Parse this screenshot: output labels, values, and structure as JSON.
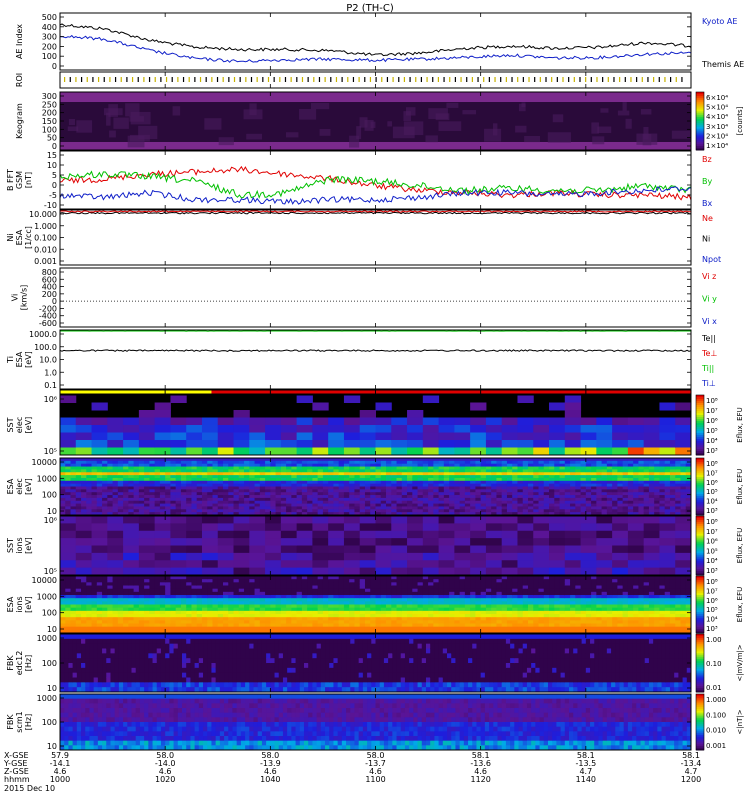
{
  "title": "P2 (TH-C)",
  "colors": {
    "black": "#000000",
    "blue": "#1020c8",
    "red": "#e00000",
    "green": "#00c000",
    "yellow": "#ffff00",
    "purple": "#3c0a5a",
    "darkbg": "#12001e"
  },
  "panels": [
    {
      "key": "ae",
      "ylabel": [
        "AE Index"
      ],
      "yticks": [
        "500",
        "400",
        "300",
        "200",
        "100",
        "0"
      ],
      "legend": [
        {
          "text": "Kyoto AE",
          "color": "#1020c8"
        },
        {
          "text": "Themis AE",
          "color": "#000000"
        }
      ]
    },
    {
      "key": "roi",
      "ylabel": [
        "ROI"
      ],
      "yticks": [],
      "legend": []
    },
    {
      "key": "keogram",
      "ylabel": [
        "Keogram"
      ],
      "yticks": [
        "300",
        "250",
        "200",
        "150",
        "100",
        "50",
        "0"
      ],
      "legend": []
    },
    {
      "key": "bfield",
      "ylabel": [
        "B FFT",
        "GSM",
        "[nT]"
      ],
      "yticks": [
        "15",
        "10",
        "5",
        "0",
        "-5",
        "-10"
      ],
      "legend": [
        {
          "text": "Bz",
          "color": "#e00000"
        },
        {
          "text": "By",
          "color": "#00c000"
        },
        {
          "text": "Bx",
          "color": "#1020c8"
        }
      ]
    },
    {
      "key": "density",
      "ylabel": [
        "Ni",
        "ESA",
        "[1/cc]"
      ],
      "yticks": [
        "10.000",
        "1.000",
        "0.100",
        "0.010",
        "0.001"
      ],
      "legend": [
        {
          "text": "Ne",
          "color": "#e00000"
        },
        {
          "text": "Ni",
          "color": "#000000"
        },
        {
          "text": "Npot",
          "color": "#1020c8"
        }
      ]
    },
    {
      "key": "velocity",
      "ylabel": [
        "Vi",
        "[km/s]"
      ],
      "yticks": [
        "800",
        "600",
        "400",
        "200",
        "0",
        "-200",
        "-400",
        "-600"
      ],
      "legend": [
        {
          "text": "Vi z",
          "color": "#e00000"
        },
        {
          "text": "Vi y",
          "color": "#00c000"
        },
        {
          "text": "Vi x",
          "color": "#1020c8"
        }
      ]
    },
    {
      "key": "temp",
      "ylabel": [
        "Ti",
        "ESA",
        "[eV]"
      ],
      "yticks": [
        "1000.0",
        "100.0",
        "10.0",
        "1.0",
        "0.1"
      ],
      "legend": [
        {
          "text": "Te||",
          "color": "#000000"
        },
        {
          "text": "Te⊥",
          "color": "#e00000"
        },
        {
          "text": "Ti||",
          "color": "#00c000"
        },
        {
          "text": "Ti⊥",
          "color": "#1020c8"
        }
      ]
    },
    {
      "key": "mode",
      "ylabel": [],
      "yticks": [],
      "legend": []
    },
    {
      "key": "sst_e",
      "ylabel": [
        "SST",
        "elec",
        "[eV]"
      ],
      "yticks": [
        "10⁶",
        "10⁵"
      ],
      "legend": []
    },
    {
      "key": "esa_e",
      "ylabel": [
        "ESA",
        "elec",
        "[eV]"
      ],
      "yticks": [
        "10000",
        "1000",
        "100",
        "10"
      ],
      "legend": []
    },
    {
      "key": "sst_i",
      "ylabel": [
        "SST",
        "ions",
        "[eV]"
      ],
      "yticks": [
        "10⁶",
        "10⁵"
      ],
      "legend": []
    },
    {
      "key": "esa_i",
      "ylabel": [
        "ESA",
        "ions",
        "[eV]"
      ],
      "yticks": [
        "10000",
        "1000",
        "100",
        "10"
      ],
      "legend": []
    },
    {
      "key": "fbk_e",
      "ylabel": [
        "FBK",
        "edc12",
        "[Hz]"
      ],
      "yticks": [
        "1000",
        "100",
        "10"
      ],
      "legend": []
    },
    {
      "key": "fbk_b",
      "ylabel": [
        "FBK",
        "scm1",
        "[Hz]"
      ],
      "yticks": [
        "1000",
        "100",
        "10"
      ],
      "legend": []
    }
  ],
  "colorbars": [
    {
      "key": "keogram",
      "ticks": [
        "6×10⁴",
        "5×10⁴",
        "4×10⁴",
        "3×10⁴",
        "2×10⁴",
        "1×10⁴"
      ],
      "label": "[counts]"
    },
    {
      "key": "sst_e",
      "ticks": [
        "10⁸",
        "10⁷",
        "10⁶",
        "10⁵",
        "10⁴",
        "10³"
      ],
      "label": "Eflux, EFU"
    },
    {
      "key": "esa_e",
      "ticks": [
        "10⁸",
        "10⁷",
        "10⁶",
        "10⁵",
        "10⁴",
        "10³"
      ],
      "label": "Eflux, EFU"
    },
    {
      "key": "sst_i",
      "ticks": [
        "10⁸",
        "10⁷",
        "10⁶",
        "10⁵",
        "10⁴",
        "10³"
      ],
      "label": "Eflux, EFU"
    },
    {
      "key": "esa_i",
      "ticks": [
        "10⁸",
        "10⁷",
        "10⁶",
        "10⁵",
        "10⁴",
        "10³"
      ],
      "label": "Eflux, EFU"
    },
    {
      "key": "fbk_e",
      "ticks": [
        "1.00",
        "0.10",
        "0.01"
      ],
      "label": "<|mV/m|>"
    },
    {
      "key": "fbk_b",
      "ticks": [
        "1.000",
        "0.100",
        "0.010",
        "0.001"
      ],
      "label": "<|nT|>"
    }
  ],
  "footer": {
    "row_labels": [
      "X-GSE",
      "Y-GSE",
      "Z-GSE",
      "hhmm",
      "2015 Dec 10"
    ],
    "columns": [
      {
        "x": "57.9",
        "y": "-14.1",
        "z": "4.6",
        "t": "1000"
      },
      {
        "x": "58.0",
        "y": "-14.0",
        "z": "4.6",
        "t": "1020"
      },
      {
        "x": "58.0",
        "y": "-13.9",
        "z": "4.6",
        "t": "1040"
      },
      {
        "x": "58.0",
        "y": "-13.7",
        "z": "4.6",
        "t": "1100"
      },
      {
        "x": "58.1",
        "y": "-13.6",
        "z": "4.6",
        "t": "1120"
      },
      {
        "x": "58.1",
        "y": "-13.5",
        "z": "4.7",
        "t": "1140"
      },
      {
        "x": "58.1",
        "y": "-13.4",
        "z": "4.7",
        "t": "1200"
      }
    ]
  },
  "chart_data": {
    "type": "line",
    "title": "P2 (TH-C)",
    "xlabel": "hhmm",
    "x": [
      "1000",
      "1020",
      "1040",
      "1100",
      "1120",
      "1140",
      "1200"
    ],
    "xlim": [
      "1000",
      "1200"
    ],
    "panels": [
      {
        "name": "AE Index",
        "ylim": [
          0,
          500
        ],
        "series": [
          {
            "name": "Kyoto AE",
            "values": [
              300,
              270,
              170,
              100,
              75,
              90,
              95,
              85,
              95,
              110,
              130,
              105,
              110,
              140,
              150
            ]
          },
          {
            "name": "Themis AE",
            "values": [
              400,
              360,
              260,
              200,
              180,
              180,
              170,
              130,
              150,
              190,
              210,
              190,
              200,
              240,
              210
            ]
          }
        ]
      },
      {
        "name": "B FFT GSM",
        "ylim": [
          -10,
          15
        ],
        "series": [
          {
            "name": "Bz",
            "values": [
              2,
              3,
              5,
              6,
              7,
              5,
              3,
              0,
              -2,
              -3,
              -4,
              -3,
              -4,
              -4,
              -5
            ]
          },
          {
            "name": "By",
            "values": [
              4,
              5,
              4,
              2,
              -4,
              -3,
              3,
              2,
              0,
              -2,
              -1,
              -2,
              -2,
              0,
              -2
            ]
          },
          {
            "name": "Bx",
            "values": [
              -4,
              -5,
              -3,
              -6,
              -6,
              -7,
              -6,
              -6,
              -5,
              -3,
              -3,
              -4,
              -3,
              -2,
              -1
            ]
          }
        ]
      },
      {
        "name": "Ni ESA",
        "ylim": [
          0.001,
          10
        ],
        "log": true,
        "series": [
          {
            "name": "Ne",
            "values": [
              8,
              8,
              8,
              8,
              8,
              8,
              8,
              8,
              8,
              8
            ]
          },
          {
            "name": "Ni",
            "values": [
              6,
              6,
              6,
              6,
              6,
              6,
              6,
              6,
              6,
              6
            ]
          }
        ]
      },
      {
        "name": "Ti ESA",
        "ylim": [
          0.1,
          1000
        ],
        "log": true,
        "series": [
          {
            "name": "Te||",
            "values": [
              40,
              40,
              40,
              40,
              40,
              40,
              40,
              40,
              40,
              40
            ]
          },
          {
            "name": "Ti||",
            "values": [
              900,
              900,
              900,
              900,
              900,
              900,
              900,
              900,
              900,
              900
            ]
          }
        ]
      }
    ]
  }
}
